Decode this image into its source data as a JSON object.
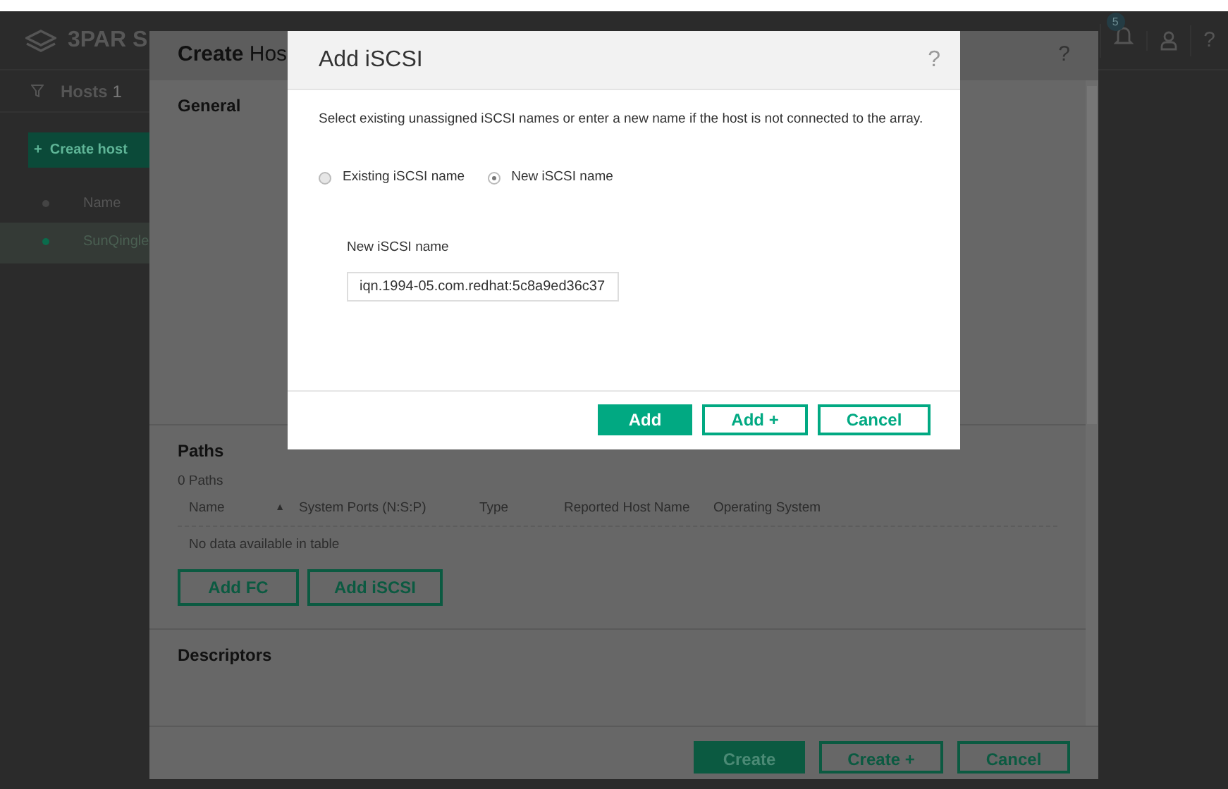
{
  "app": {
    "logo_text": "3PAR S",
    "notification_count": "5",
    "help": "?",
    "sidebar": {
      "title": "Hosts",
      "count": "1",
      "create_button": {
        "icon": "+",
        "label": "Create host"
      },
      "columns": [
        "Name"
      ],
      "rows": [
        {
          "name": "SunQingle",
          "selected": true,
          "color": "#0b6b4c"
        }
      ]
    }
  },
  "create_panel": {
    "title": "Create",
    "title_rest": "Hos",
    "help": "?",
    "sections": [
      {
        "kind": "general",
        "title": "General"
      },
      {
        "kind": "paths",
        "title": "Paths",
        "count": "0 Paths",
        "columns": [
          {
            "label": "Name",
            "sort": "▲"
          },
          {
            "label": "System Ports (N:S:P)"
          },
          {
            "label": "Type"
          },
          {
            "label": "Reported Host Name"
          },
          {
            "label": "Operating System"
          }
        ],
        "empty_text": "No data available in table",
        "buttons": [
          "Add FC",
          "Add iSCSI"
        ]
      },
      {
        "kind": "descriptors",
        "title": "Descriptors"
      }
    ],
    "buttons": [
      {
        "label": "Create",
        "primary": true
      },
      {
        "label": "Create +",
        "primary": false
      },
      {
        "label": "Cancel",
        "primary": false
      }
    ]
  },
  "dialog": {
    "title": "Add iSCSI",
    "help": "?",
    "description": "Select existing unassigned iSCSI names or enter a new name if the host is not connected to the array.",
    "options": [
      {
        "label": "Existing iSCSI name",
        "selected": false
      },
      {
        "label": "New iSCSI name",
        "selected": true
      }
    ],
    "field": {
      "label": "New iSCSI name",
      "value": "iqn.1994-05.com.redhat:5c8a9ed36c37"
    },
    "buttons": [
      {
        "label": "Add",
        "primary": true
      },
      {
        "label": "Add +",
        "primary": false
      },
      {
        "label": "Cancel",
        "primary": false
      }
    ]
  }
}
